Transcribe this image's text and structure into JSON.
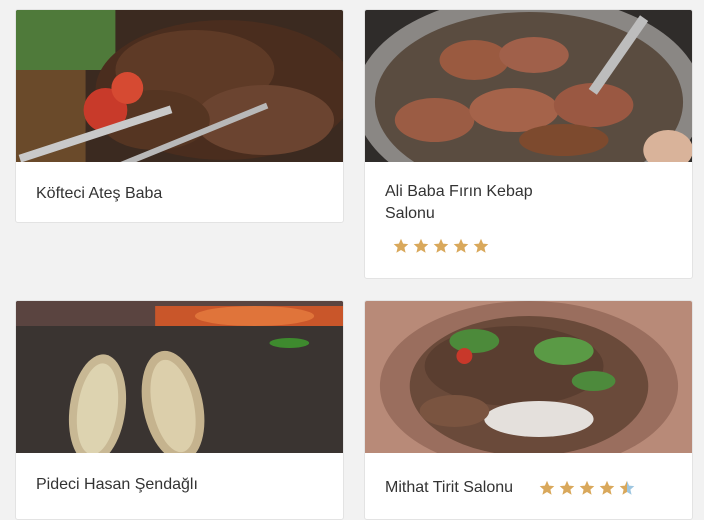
{
  "restaurants": [
    {
      "name": "Köfteci Ateş Baba",
      "photo": "grilled-meat-skewers-with-tomatoes",
      "rating": null
    },
    {
      "name": "Ali Baba Fırın Kebap Salonu",
      "photo": "oven-roasted-meat-pan",
      "rating": 5
    },
    {
      "name": "Pideci Hasan Şendağlı",
      "photo": "pide-in-wood-oven",
      "rating": null
    },
    {
      "name": "Mithat Tirit Salonu",
      "photo": "tirit-dish-with-herbs",
      "rating": 4.5
    }
  ],
  "colors": {
    "star": "#d9a85b",
    "star_empty": "#9ec6e0",
    "background": "#f2f2f2",
    "text": "#333333"
  },
  "icons": {
    "rating": "star-icon"
  }
}
